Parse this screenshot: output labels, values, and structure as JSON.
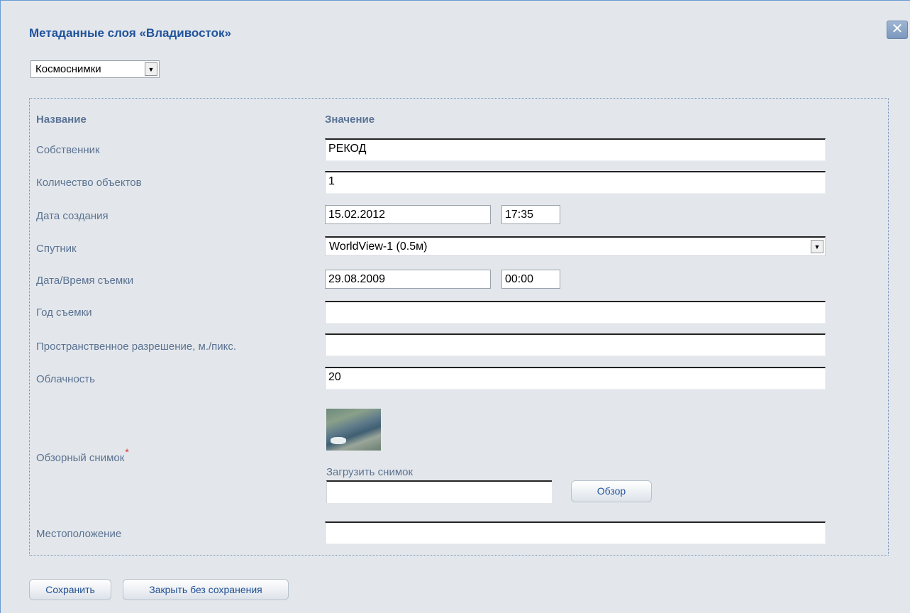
{
  "dialog": {
    "title": "Метаданные слоя «Владивосток»",
    "close_icon": "close-icon"
  },
  "type_select": {
    "value": "Космоснимки"
  },
  "table": {
    "header_name": "Название",
    "header_value": "Значение"
  },
  "fields": {
    "owner": {
      "label": "Собственник",
      "value": "РЕКОД"
    },
    "object_count": {
      "label": "Количество объектов",
      "value": "1"
    },
    "created": {
      "label": "Дата создания",
      "date": "15.02.2012",
      "time": "17:35"
    },
    "satellite": {
      "label": "Спутник",
      "value": "WorldView-1 (0.5м)"
    },
    "shot_datetime": {
      "label": "Дата/Время съемки",
      "date": "29.08.2009",
      "time": "00:00"
    },
    "shot_year": {
      "label": "Год съемки",
      "value": ""
    },
    "resolution": {
      "label": "Пространственное разрешение, м./пикс.",
      "value": ""
    },
    "cloudiness": {
      "label": "Облачность",
      "value": "20"
    },
    "preview": {
      "label": "Обзорный снимок",
      "required_mark": "*",
      "upload_label": "Загрузить снимок",
      "browse_label": "Обзор"
    },
    "location": {
      "label": "Местоположение",
      "value": ""
    }
  },
  "buttons": {
    "save": "Сохранить",
    "close_no_save": "Закрыть без сохранения"
  }
}
